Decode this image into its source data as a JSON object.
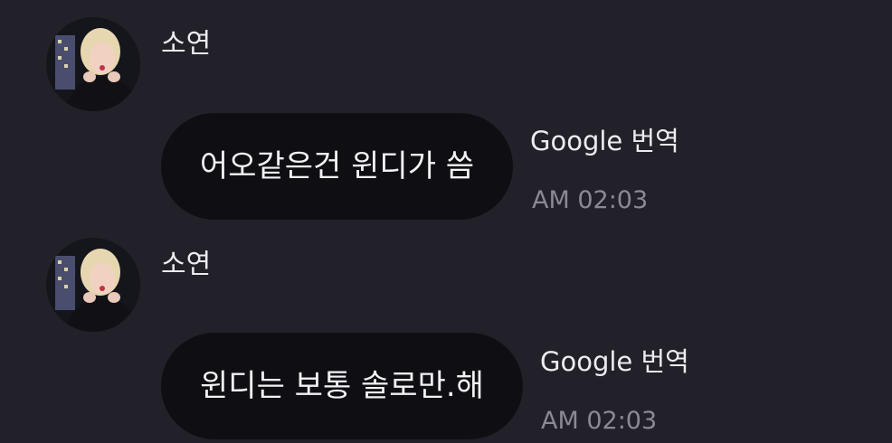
{
  "messages": [
    {
      "sender": "소연",
      "avatar_icon": "profile-photo",
      "text": "어오같은건 윈디가 씀",
      "translate_label": "Google 번역",
      "time": "AM 02:03"
    },
    {
      "sender": "소연",
      "avatar_icon": "profile-photo",
      "text": "윈디는 보통 솔로만.해",
      "translate_label": "Google 번역",
      "time": "AM 02:03"
    }
  ],
  "colors": {
    "background": "#222129",
    "bubble": "#0f0f13",
    "text": "#f2f2f4",
    "timestamp": "#8a8a92"
  }
}
